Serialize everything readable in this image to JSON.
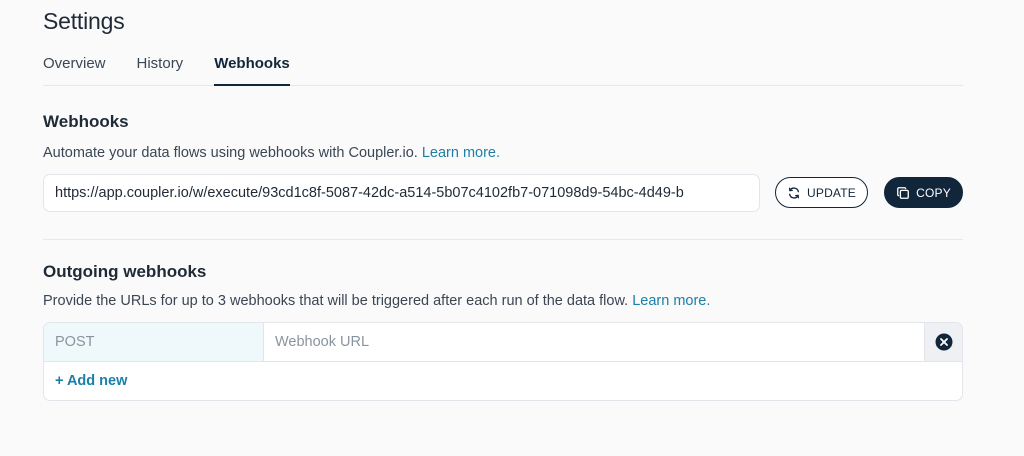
{
  "header": {
    "title": "Settings"
  },
  "tabs": [
    {
      "label": "Overview",
      "active": false
    },
    {
      "label": "History",
      "active": false
    },
    {
      "label": "Webhooks",
      "active": true
    }
  ],
  "webhooks": {
    "title": "Webhooks",
    "description": "Automate your data flows using webhooks with Coupler.io.",
    "learn_more": "Learn more.",
    "url": "https://app.coupler.io/w/execute/93cd1c8f-5087-42dc-a514-5b07c4102fb7-071098d9-54bc-4d49-b",
    "update_label": "UPDATE",
    "update_icon": "refresh-icon",
    "copy_label": "COPY",
    "copy_icon": "copy-icon"
  },
  "outgoing": {
    "title": "Outgoing webhooks",
    "description": "Provide the URLs for up to 3 webhooks that will be triggered after each run of the data flow.",
    "learn_more": "Learn more.",
    "rows": [
      {
        "method": "POST",
        "url_value": "",
        "url_placeholder": "Webhook URL"
      }
    ],
    "remove_icon": "close-circle-icon",
    "add_new_label": "+ Add new"
  },
  "colors": {
    "primary": "#11263a",
    "link": "#1b7fa8",
    "background": "#fafafa",
    "method_bg": "#eff8fb"
  }
}
